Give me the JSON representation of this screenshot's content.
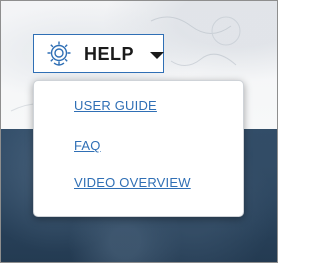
{
  "help_menu": {
    "button_label": "HELP",
    "button_icon": "gear-head-icon",
    "caret_icon": "caret-down-icon",
    "accent_color": "#2f6fb5",
    "items": [
      {
        "label": "USER GUIDE"
      },
      {
        "label": "FAQ"
      },
      {
        "label": "VIDEO OVERVIEW"
      }
    ]
  }
}
